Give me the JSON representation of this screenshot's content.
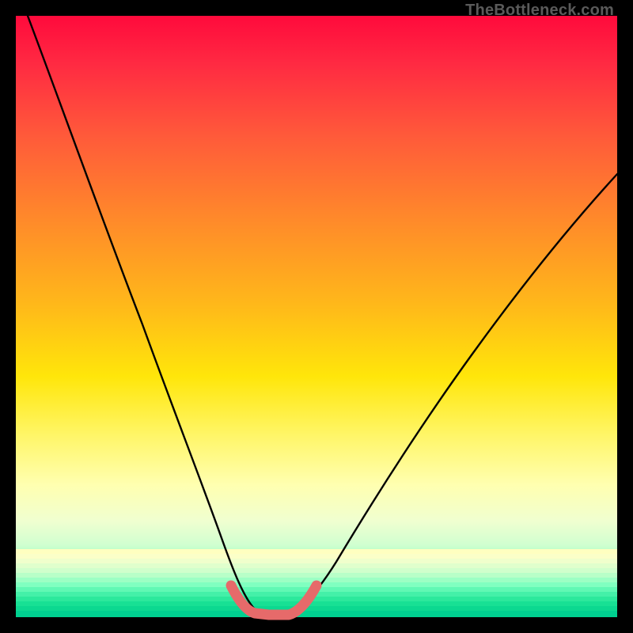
{
  "watermark": {
    "text": "TheBottleneck.com"
  },
  "chart_data": {
    "type": "line",
    "title": "",
    "xlabel": "",
    "ylabel": "",
    "xlim": [
      0,
      100
    ],
    "ylim": [
      0,
      100
    ],
    "series": [
      {
        "name": "main-curve",
        "x": [
          0,
          5,
          10,
          15,
          20,
          25,
          28,
          31,
          34,
          36,
          38,
          40,
          42,
          44,
          47,
          50,
          55,
          60,
          65,
          70,
          75,
          80,
          85,
          90,
          95,
          100
        ],
        "values": [
          100,
          85,
          71,
          58,
          46,
          35,
          28,
          21,
          14,
          9,
          5,
          2,
          1,
          1,
          2,
          4,
          9,
          15,
          22,
          29,
          36,
          43,
          50,
          57,
          63,
          70
        ]
      },
      {
        "name": "highlight-segment",
        "x": [
          35,
          37,
          39,
          41,
          43,
          45,
          47
        ],
        "values": [
          5,
          2,
          1,
          1,
          1,
          2,
          4
        ]
      }
    ],
    "gradient_stops": [
      {
        "pos": 0,
        "color": "#ff0a3c"
      },
      {
        "pos": 8,
        "color": "#ff2a42"
      },
      {
        "pos": 20,
        "color": "#ff5a3a"
      },
      {
        "pos": 34,
        "color": "#ff8a2a"
      },
      {
        "pos": 48,
        "color": "#ffb81a"
      },
      {
        "pos": 60,
        "color": "#ffe60a"
      },
      {
        "pos": 70,
        "color": "#fff66a"
      },
      {
        "pos": 78,
        "color": "#ffffb0"
      },
      {
        "pos": 84,
        "color": "#f0ffd0"
      },
      {
        "pos": 88,
        "color": "#d0ffd0"
      },
      {
        "pos": 92,
        "color": "#80ffb0"
      },
      {
        "pos": 96,
        "color": "#30e8a0"
      },
      {
        "pos": 100,
        "color": "#00d090"
      }
    ],
    "colors": {
      "curve": "#000000",
      "highlight": "#e66a6a",
      "frame": "#000000"
    }
  }
}
